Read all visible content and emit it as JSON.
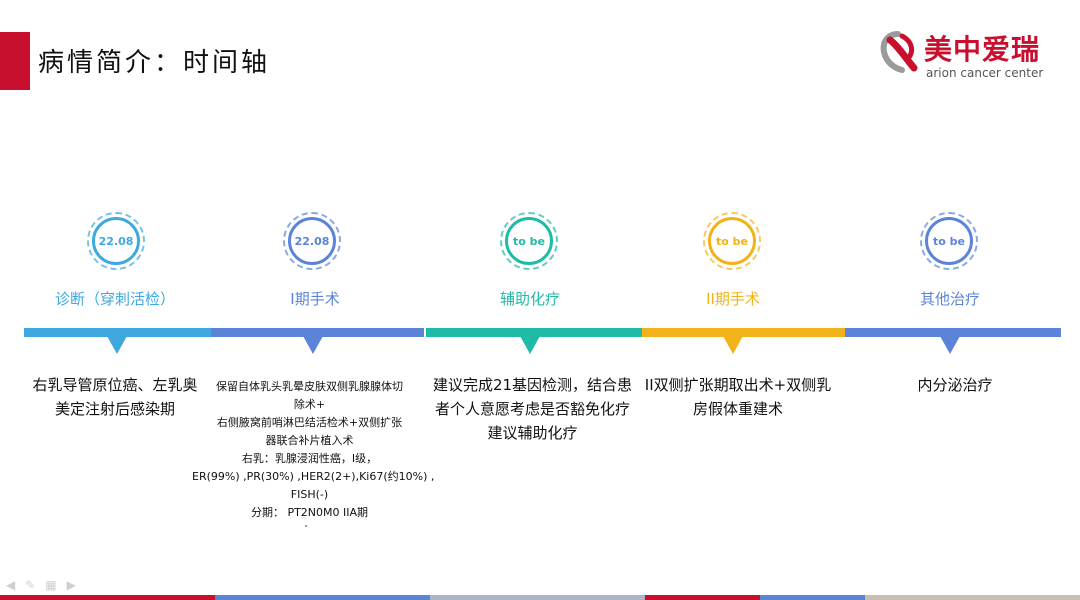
{
  "title": "病情简介：时间轴",
  "logo": {
    "cn": "美中爱瑞",
    "en": "arion cancer center"
  },
  "colors": {
    "brand_red": "#c8102e",
    "cyan": "#3ea8df",
    "blue": "#5b84d8",
    "teal": "#1fbba6",
    "yellow": "#f2b31a"
  },
  "milestones": [
    {
      "date": "22.08",
      "label": "诊断（穿刺活检）",
      "color": "#3ea8df",
      "desc": [
        "右乳导管原位癌、左乳奥",
        "美定注射后感染期"
      ]
    },
    {
      "date": "22.08",
      "label": "I期手术",
      "color": "#5b84d8",
      "desc": [
        "保留自体乳头乳晕皮肤双侧乳腺腺体切",
        "除术+",
        "右侧腋窝前哨淋巴结活检术+双侧扩张",
        "器联合补片植入术",
        "右乳：乳腺浸润性癌，I级，",
        "ER(99%) ,PR(30%) ,HER2(2+),Ki67(约10%) ,",
        "FISH(-)",
        "分期： PT2N0M0 IIA期"
      ]
    },
    {
      "date": "to be",
      "label": "辅助化疗",
      "color": "#1fbba6",
      "desc": [
        "建议完成21基因检测，结合患",
        "者个人意愿考虑是否豁免化疗",
        "建议辅助化疗"
      ]
    },
    {
      "date": "to be",
      "label": "II期手术",
      "color": "#f2b31a",
      "desc": [
        "II双侧扩张期取出术+双侧乳",
        "房假体重建术"
      ]
    },
    {
      "date": "to be",
      "label": "其他治疗",
      "color": "#5b84d8",
      "desc": [
        "内分泌治疗"
      ]
    }
  ],
  "footer_colors": [
    "#c8102e",
    "#5b84d8",
    "#a9b6c8",
    "#c8102e",
    "#5b84d8",
    "#c9bfb0"
  ]
}
